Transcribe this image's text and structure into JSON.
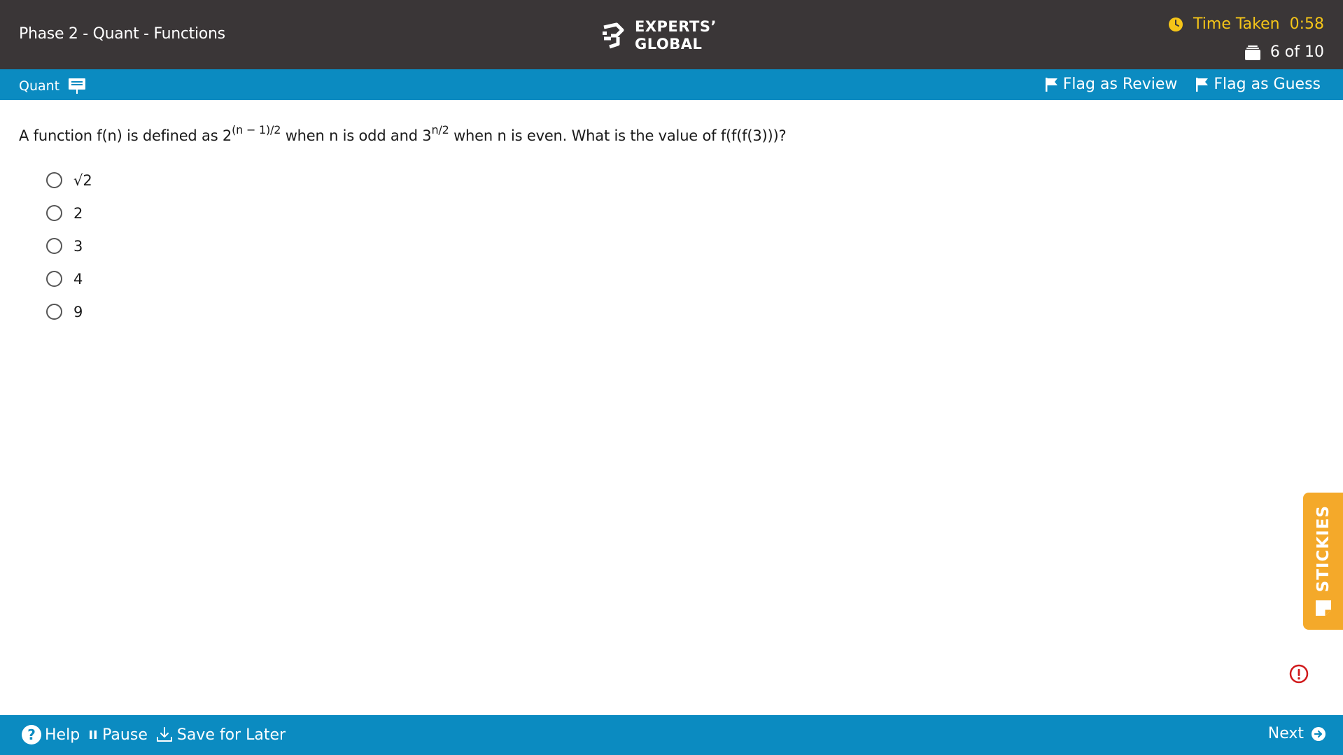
{
  "header": {
    "title": "Phase 2 - Quant - Functions",
    "logo_line1": "EXPERTS’",
    "logo_line2": "GLOBAL",
    "timer_label": "Time Taken",
    "timer_value": "0:58",
    "progress": "6 of 10"
  },
  "section_bar": {
    "section": "Quant",
    "flag_review": "Flag as Review",
    "flag_guess": "Flag as Guess"
  },
  "question": {
    "p1": "A function f(n) is defined as 2",
    "sup1": "(n − 1)/2",
    "p2": " when n is odd and 3",
    "sup2": "n/2",
    "p3": " when n is even. What is the value of f(f(f(3)))?",
    "options": [
      "√2",
      "2",
      "3",
      "4",
      "9"
    ]
  },
  "stickies_label": "STICKIES",
  "footer": {
    "help": "Help",
    "pause": "Pause",
    "save": "Save for Later",
    "next": "Next"
  },
  "colors": {
    "header_bg": "#3a3637",
    "accent_blue": "#0b8bc1",
    "timer_yellow": "#f5c518",
    "stickies_orange": "#f4a92a",
    "alert_red": "#d0191b"
  }
}
